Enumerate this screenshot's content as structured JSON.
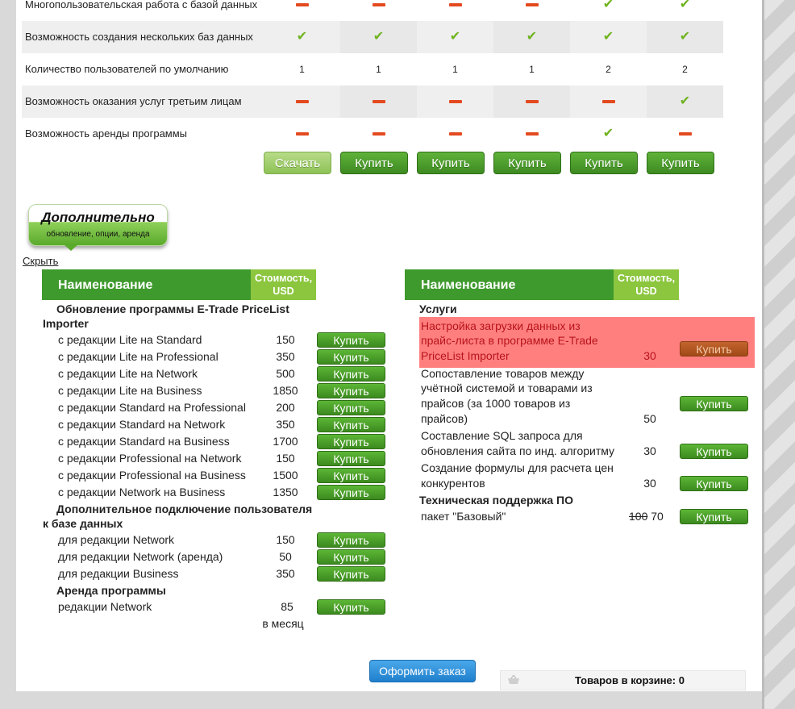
{
  "comparison": {
    "rows": [
      {
        "label": "Многопользовательская работа с базой данных",
        "cells": [
          "dash",
          "dash",
          "dash",
          "dash",
          "check",
          "check"
        ]
      },
      {
        "label": "Возможность создания нескольких баз данных",
        "cells": [
          "check",
          "check",
          "check",
          "check",
          "check",
          "check"
        ]
      },
      {
        "label": "Количество пользователей по умолчанию",
        "cells": [
          "1",
          "1",
          "1",
          "1",
          "2",
          "2"
        ]
      },
      {
        "label": "Возможность оказания услуг третьим лицам",
        "cells": [
          "dash",
          "dash",
          "dash",
          "dash",
          "dash",
          "check"
        ]
      },
      {
        "label": "Возможность аренды программы",
        "cells": [
          "dash",
          "dash",
          "dash",
          "dash",
          "check",
          "dash"
        ]
      }
    ],
    "buttons": [
      "Скачать",
      "Купить",
      "Купить",
      "Купить",
      "Купить",
      "Купить"
    ]
  },
  "extra": {
    "title": "Дополнительно",
    "subtitle": "обновление, опции, аренда",
    "hide_link": "Скрыть"
  },
  "left_table": {
    "header_name": "Наименование",
    "header_cost_line1": "Стоимость,",
    "header_cost_line2": "USD",
    "section1_line1": "Обновление программы E-Trade PriceList",
    "section1_line2": "Importer",
    "upgrades": [
      {
        "name": "с редакции Lite на Standard",
        "price": "150",
        "buy": "Купить"
      },
      {
        "name": "с редакции Lite на Professional",
        "price": "350",
        "buy": "Купить"
      },
      {
        "name": "с редакции Lite на Network",
        "price": "500",
        "buy": "Купить"
      },
      {
        "name": "с редакции Lite на Business",
        "price": "1850",
        "buy": "Купить"
      },
      {
        "name": "с редакции Standard на Professional",
        "price": "200",
        "buy": "Купить"
      },
      {
        "name": "с редакции Standard на Network",
        "price": "350",
        "buy": "Купить"
      },
      {
        "name": "с редакции Standard на Business",
        "price": "1700",
        "buy": "Купить"
      },
      {
        "name": "с редакции Professional на Network",
        "price": "150",
        "buy": "Купить"
      },
      {
        "name": "с редакции Professional на Business",
        "price": "1500",
        "buy": "Купить"
      },
      {
        "name": "с редакции Network на Business",
        "price": "1350",
        "buy": "Купить"
      }
    ],
    "section2_line1": "Дополнительное подключение пользователя",
    "section2_line2": "к базе данных",
    "users": [
      {
        "name": "для редакции Network",
        "price": "150",
        "buy": "Купить"
      },
      {
        "name": "для редакции Network (аренда)",
        "price": "50",
        "buy": "Купить"
      },
      {
        "name": "для редакции Business",
        "price": "350",
        "buy": "Купить"
      }
    ],
    "section3": "Аренда программы",
    "rent": {
      "name": "редакции Network",
      "price": "85",
      "price_note": "в месяц",
      "buy": "Купить"
    }
  },
  "right_table": {
    "header_name": "Наименование",
    "header_cost_line1": "Стоимость,",
    "header_cost_line2": "USD",
    "section1": "Услуги",
    "services": [
      {
        "lines": [
          "Настройка загрузки данных из",
          "прайс-листа в программе E-Trade",
          "PriceList Importer"
        ],
        "price": "30",
        "buy": "Купить"
      },
      {
        "lines": [
          "Сопоставление товаров между",
          "учётной системой и товарами из",
          "прайсов (за 1000 товаров из",
          "прайсов)"
        ],
        "price": "50",
        "buy": "Купить"
      },
      {
        "lines": [
          "Составление SQL запроса для",
          "обновления сайта по инд. алгоритму"
        ],
        "price": "30",
        "buy": "Купить"
      },
      {
        "lines": [
          "Создание формулы для расчета цен",
          "конкурентов"
        ],
        "price": "30",
        "buy": "Купить"
      }
    ],
    "section2": "Техническая поддержка ПО",
    "support": {
      "name": "пакет \"Базовый\"",
      "old_price": "100",
      "price": "70",
      "buy": "Купить"
    }
  },
  "footer": {
    "order_button": "Оформить заказ",
    "cart_text": "Товаров в корзине: 0"
  },
  "colors": {
    "accent_green": "#3f9a2d",
    "light_green": "#8cc63f",
    "dash_red": "#e34a1f",
    "highlight": "#ff7f7f",
    "order_blue": "#1f7fcc"
  }
}
